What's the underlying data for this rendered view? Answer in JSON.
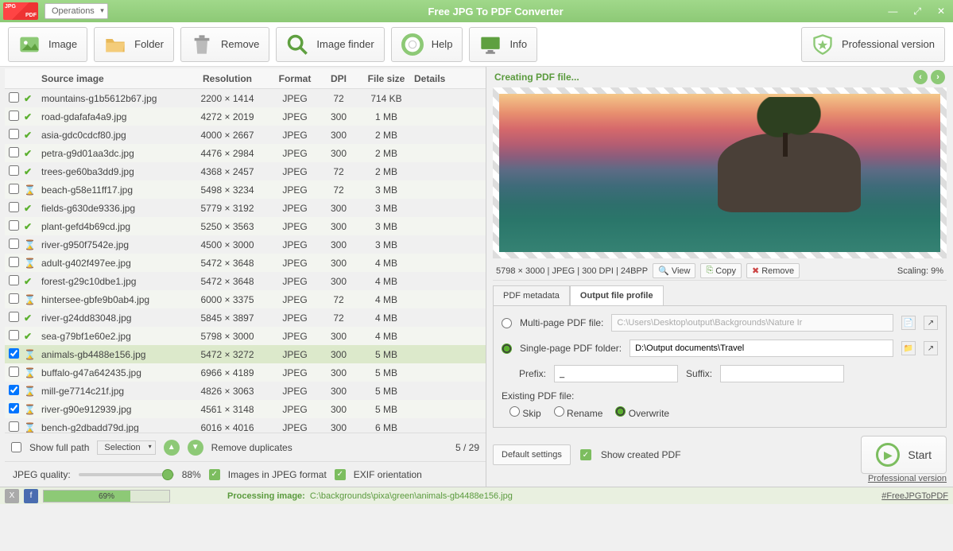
{
  "titlebar": {
    "operations": "Operations",
    "title": "Free JPG To PDF Converter"
  },
  "toolbar": {
    "image": "Image",
    "folder": "Folder",
    "remove": "Remove",
    "image_finder": "Image finder",
    "help": "Help",
    "info": "Info",
    "professional": "Professional version"
  },
  "columns": {
    "src": "Source image",
    "res": "Resolution",
    "fmt": "Format",
    "dpi": "DPI",
    "size": "File size",
    "det": "Details"
  },
  "rows": [
    {
      "chk": false,
      "st": "done",
      "name": "mountains-g1b5612b67.jpg",
      "res": "2200 × 1414",
      "fmt": "JPEG",
      "dpi": "72",
      "size": "714 KB"
    },
    {
      "chk": false,
      "st": "done",
      "name": "road-gdafafa4a9.jpg",
      "res": "4272 × 2019",
      "fmt": "JPEG",
      "dpi": "300",
      "size": "1 MB"
    },
    {
      "chk": false,
      "st": "done",
      "name": "asia-gdc0cdcf80.jpg",
      "res": "4000 × 2667",
      "fmt": "JPEG",
      "dpi": "300",
      "size": "2 MB"
    },
    {
      "chk": false,
      "st": "done",
      "name": "petra-g9d01aa3dc.jpg",
      "res": "4476 × 2984",
      "fmt": "JPEG",
      "dpi": "300",
      "size": "2 MB"
    },
    {
      "chk": false,
      "st": "done",
      "name": "trees-ge60ba3dd9.jpg",
      "res": "4368 × 2457",
      "fmt": "JPEG",
      "dpi": "72",
      "size": "2 MB"
    },
    {
      "chk": false,
      "st": "proc",
      "name": "beach-g58e11ff17.jpg",
      "res": "5498 × 3234",
      "fmt": "JPEG",
      "dpi": "72",
      "size": "3 MB"
    },
    {
      "chk": false,
      "st": "done",
      "name": "fields-g630de9336.jpg",
      "res": "5779 × 3192",
      "fmt": "JPEG",
      "dpi": "300",
      "size": "3 MB"
    },
    {
      "chk": false,
      "st": "done",
      "name": "plant-gefd4b69cd.jpg",
      "res": "5250 × 3563",
      "fmt": "JPEG",
      "dpi": "300",
      "size": "3 MB"
    },
    {
      "chk": false,
      "st": "proc",
      "name": "river-g950f7542e.jpg",
      "res": "4500 × 3000",
      "fmt": "JPEG",
      "dpi": "300",
      "size": "3 MB"
    },
    {
      "chk": false,
      "st": "proc",
      "name": "adult-g402f497ee.jpg",
      "res": "5472 × 3648",
      "fmt": "JPEG",
      "dpi": "300",
      "size": "4 MB"
    },
    {
      "chk": false,
      "st": "done",
      "name": "forest-g29c10dbe1.jpg",
      "res": "5472 × 3648",
      "fmt": "JPEG",
      "dpi": "300",
      "size": "4 MB"
    },
    {
      "chk": false,
      "st": "proc",
      "name": "hintersee-gbfe9b0ab4.jpg",
      "res": "6000 × 3375",
      "fmt": "JPEG",
      "dpi": "72",
      "size": "4 MB"
    },
    {
      "chk": false,
      "st": "done",
      "name": "river-g24dd83048.jpg",
      "res": "5845 × 3897",
      "fmt": "JPEG",
      "dpi": "72",
      "size": "4 MB"
    },
    {
      "chk": false,
      "st": "done",
      "name": "sea-g79bf1e60e2.jpg",
      "res": "5798 × 3000",
      "fmt": "JPEG",
      "dpi": "300",
      "size": "4 MB"
    },
    {
      "chk": true,
      "st": "proc",
      "name": "animals-gb4488e156.jpg",
      "res": "5472 × 3272",
      "fmt": "JPEG",
      "dpi": "300",
      "size": "5 MB",
      "sel": true
    },
    {
      "chk": false,
      "st": "proc",
      "name": "buffalo-g47a642435.jpg",
      "res": "6966 × 4189",
      "fmt": "JPEG",
      "dpi": "300",
      "size": "5 MB"
    },
    {
      "chk": true,
      "st": "proc",
      "name": "mill-ge7714c21f.jpg",
      "res": "4826 × 3063",
      "fmt": "JPEG",
      "dpi": "300",
      "size": "5 MB"
    },
    {
      "chk": true,
      "st": "proc",
      "name": "river-g90e912939.jpg",
      "res": "4561 × 3148",
      "fmt": "JPEG",
      "dpi": "300",
      "size": "5 MB"
    },
    {
      "chk": false,
      "st": "proc",
      "name": "bench-g2dbadd79d.jpg",
      "res": "6016 × 4016",
      "fmt": "JPEG",
      "dpi": "300",
      "size": "6 MB"
    }
  ],
  "list_footer": {
    "show_full_path": "Show full path",
    "selection": "Selection",
    "remove_dup": "Remove duplicates",
    "pager": "5 / 29"
  },
  "quality": {
    "jpeg_quality": "JPEG quality:",
    "pct": "88%",
    "jpeg_format": "Images in JPEG format",
    "exif": "EXIF orientation"
  },
  "statusbar": {
    "progress": "69%",
    "label": "Processing image:",
    "path": "C:\\backgrounds\\pixa\\green\\animals-gb4488e156.jpg",
    "hashtag": "#FreeJPGToPDF"
  },
  "preview": {
    "header": "Creating PDF file...",
    "meta": "5798 × 3000  |  JPEG  |  300 DPI  |  24BPP",
    "view": "View",
    "copy": "Copy",
    "remove": "Remove",
    "scaling": "Scaling: 9%"
  },
  "tabs": {
    "pdf_meta": "PDF metadata",
    "out_profile": "Output file profile"
  },
  "profile": {
    "multi": "Multi-page PDF file:",
    "multi_path": "C:\\Users\\Desktop\\output\\Backgrounds\\Nature Ir",
    "single": "Single-page PDF folder:",
    "single_path": "D:\\Output documents\\Travel",
    "prefix": "Prefix:",
    "prefix_val": "_",
    "suffix": "Suffix:",
    "existing": "Existing PDF file:",
    "skip": "Skip",
    "rename": "Rename",
    "overwrite": "Overwrite",
    "defaults": "Default settings",
    "show_created": "Show created PDF",
    "pro_link": "Professional version",
    "start": "Start"
  }
}
